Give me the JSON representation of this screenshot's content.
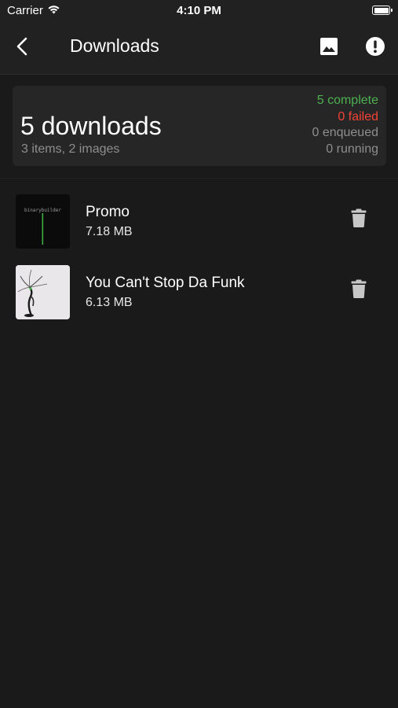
{
  "status_bar": {
    "carrier": "Carrier",
    "time": "4:10 PM",
    "wifi_icon": "wifi-icon",
    "battery_icon": "battery-icon"
  },
  "nav": {
    "back_icon": "chevron-left-icon",
    "title": "Downloads",
    "image_icon": "image-icon",
    "alert_icon": "alert-circle-icon"
  },
  "summary": {
    "count_label": "5 downloads",
    "sub_label": "3 items, 2 images",
    "complete": "5 complete",
    "failed": "0 failed",
    "enqueued": "0 enqueued",
    "running": "0 running"
  },
  "items": [
    {
      "title": "Promo",
      "size": "7.18 MB",
      "thumb_text": "binarybuilder",
      "delete_icon": "trash-icon"
    },
    {
      "title": "You Can't Stop Da Funk",
      "size": "6.13 MB",
      "delete_icon": "trash-icon"
    }
  ],
  "colors": {
    "background": "#1a1a1a",
    "bar": "#212121",
    "card": "#262626",
    "complete": "#4caf50",
    "failed": "#f44336",
    "muted": "#8e8e8e",
    "icon": "#c7c7c7"
  }
}
